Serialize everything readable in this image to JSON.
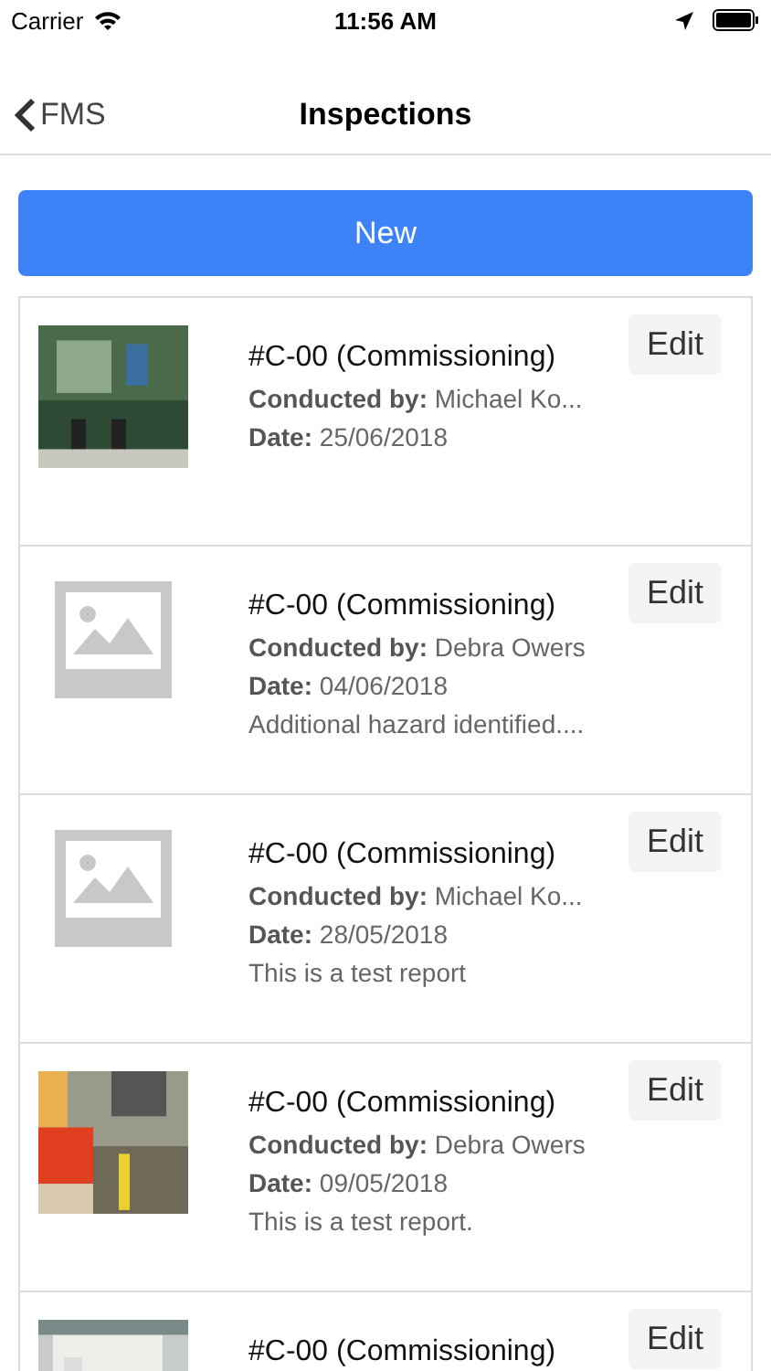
{
  "status_bar": {
    "carrier": "Carrier",
    "time": "11:56 AM"
  },
  "nav": {
    "back": "FMS",
    "title": "Inspections"
  },
  "new_button": "New",
  "inspections": [
    {
      "title": "#C-00 (Commissioning)",
      "conducted_by": "**Conducted by:** Michael Ko...",
      "date": "**Date:** 25/06/2018",
      "edit": "Edit"
    },
    {
      "kind": "placeholder",
      "title": "#C-00 (Commissioning)",
      "conducted_by": "**Conducted by:** Debra Owers",
      "date": "**Date:** 04/06/2018",
      "note": "Additional hazard identified....",
      "edit": "Edit"
    },
    {
      "kind": "placeholder",
      "title": "#C-00 (Commissioning)",
      "conducted_by": "**Conducted by:** Michael Ko...",
      "date": "**Date:** 28/05/2018",
      "note": "This is a test report",
      "edit": "Edit"
    },
    {
      "title": "#C-00 (Commissioning)",
      "conducted_by": "**Conducted by:** Debra Owers",
      "date": "**Date:** 09/05/2018",
      "note": "This is a test report.",
      "edit": "Edit"
    },
    {
      "title": "#C-00 (Commissioning)",
      "edit": "Edit"
    }
  ]
}
